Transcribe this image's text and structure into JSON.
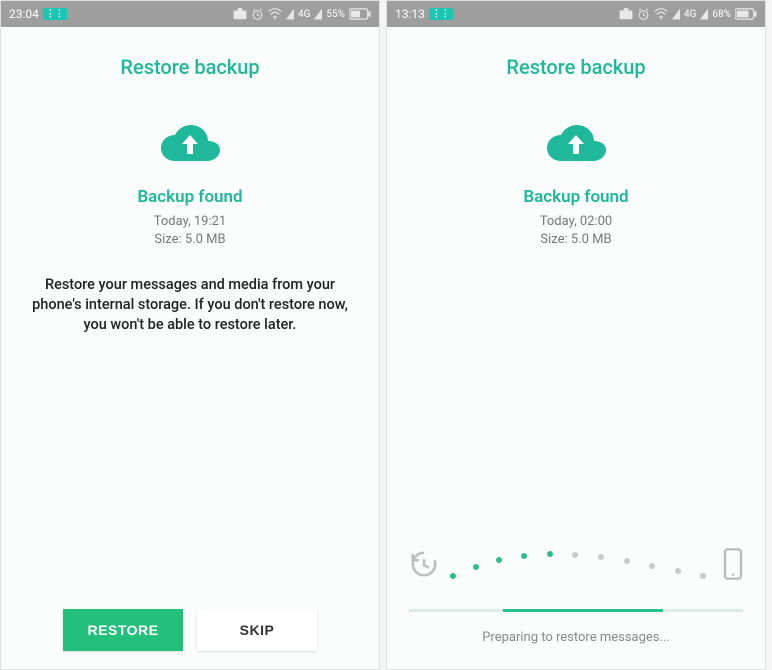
{
  "left": {
    "status": {
      "time": "23:04",
      "network": "4G",
      "battery": "55%"
    },
    "title": "Restore backup",
    "found": "Backup found",
    "when": "Today, 19:21",
    "size": "Size: 5.0 MB",
    "body": "Restore your messages and media from your phone's internal storage. If you don't restore now, you won't be able to restore later.",
    "restore_label": "RESTORE",
    "skip_label": "SKIP"
  },
  "right": {
    "status": {
      "time": "13:13",
      "network": "4G",
      "battery": "68%"
    },
    "title": "Restore backup",
    "found": "Backup found",
    "when": "Today, 02:00",
    "size": "Size: 5.0 MB",
    "progress_label": "Preparing to restore messages..."
  },
  "colors": {
    "accent": "#1fb89a",
    "button": "#22c07a"
  }
}
